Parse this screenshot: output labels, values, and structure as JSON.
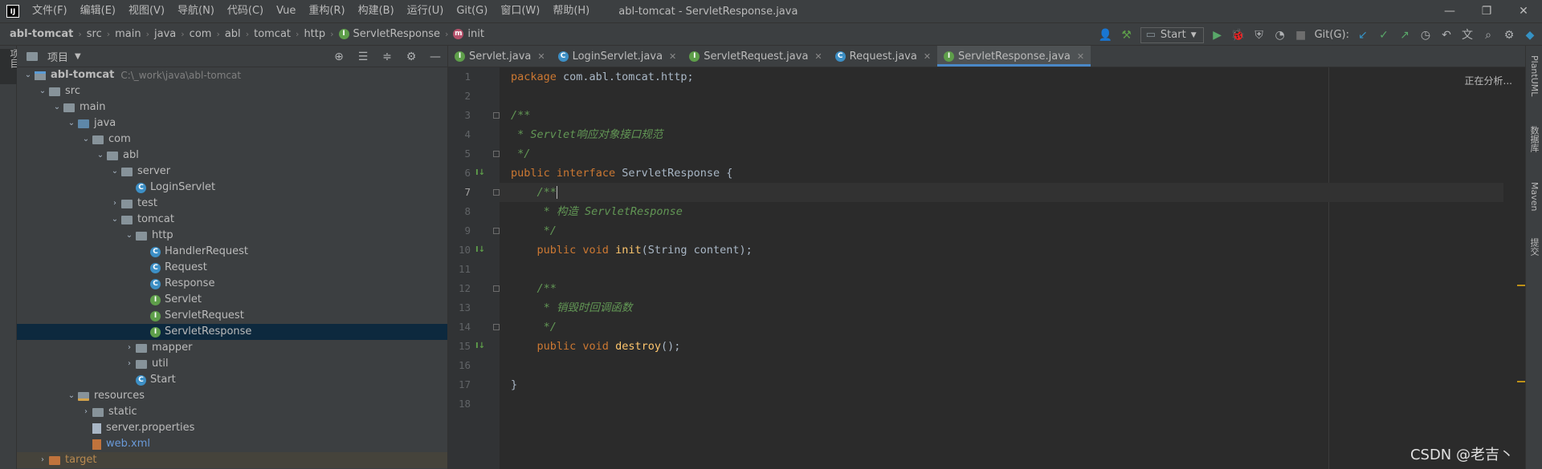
{
  "menubar": {
    "logo": "IJ",
    "items": [
      "文件(F)",
      "编辑(E)",
      "视图(V)",
      "导航(N)",
      "代码(C)",
      "Vue",
      "重构(R)",
      "构建(B)",
      "运行(U)",
      "Git(G)",
      "窗口(W)",
      "帮助(H)"
    ],
    "window_title": "abl-tomcat - ServletResponse.java"
  },
  "breadcrumb": {
    "items": [
      "abl-tomcat",
      "src",
      "main",
      "java",
      "com",
      "abl",
      "tomcat",
      "http",
      "ServletResponse",
      "init"
    ]
  },
  "toolbar": {
    "run_config": "Start",
    "git_label": "Git(G):"
  },
  "left_stripe": {
    "project_tab": "项目"
  },
  "right_stripe": {
    "tabs": [
      "PlantUML",
      "数据库",
      "Maven",
      "提交"
    ]
  },
  "project_panel": {
    "title": "项目",
    "tree": [
      {
        "label": "abl-tomcat",
        "path": "C:\\_work\\java\\abl-tomcat"
      },
      {
        "label": "src"
      },
      {
        "label": "main"
      },
      {
        "label": "java"
      },
      {
        "label": "com"
      },
      {
        "label": "abl"
      },
      {
        "label": "server"
      },
      {
        "label": "LoginServlet"
      },
      {
        "label": "test"
      },
      {
        "label": "tomcat"
      },
      {
        "label": "http"
      },
      {
        "label": "HandlerRequest"
      },
      {
        "label": "Request"
      },
      {
        "label": "Response"
      },
      {
        "label": "Servlet"
      },
      {
        "label": "ServletRequest"
      },
      {
        "label": "ServletResponse"
      },
      {
        "label": "mapper"
      },
      {
        "label": "util"
      },
      {
        "label": "Start"
      },
      {
        "label": "resources"
      },
      {
        "label": "static"
      },
      {
        "label": "server.properties"
      },
      {
        "label": "web.xml"
      },
      {
        "label": "target"
      }
    ]
  },
  "editor": {
    "tabs": [
      {
        "label": "Servlet.java"
      },
      {
        "label": "LoginServlet.java"
      },
      {
        "label": "ServletRequest.java"
      },
      {
        "label": "Request.java"
      },
      {
        "label": "ServletResponse.java"
      }
    ],
    "status": "正在分析...",
    "line_numbers": [
      "1",
      "2",
      "3",
      "4",
      "5",
      "6",
      "7",
      "8",
      "9",
      "10",
      "11",
      "12",
      "13",
      "14",
      "15",
      "16",
      "17",
      "18"
    ],
    "code": {
      "l1_kw": "package",
      "l1_rest": " com.abl.tomcat.http;",
      "l3": "/**",
      "l4": " * Servlet响应对象接口规范",
      "l5": " */",
      "l6_kw1": "public",
      "l6_kw2": "interface",
      "l6_rest": " ServletResponse {",
      "l7": "    /**",
      "l8": "     * 构造 ServletResponse",
      "l9": "     */",
      "l10_kw1": "    public",
      "l10_kw2": "void",
      "l10_fn": "init",
      "l10_rest": "(String content);",
      "l12": "    /**",
      "l13": "     * 销毁时回调函数",
      "l14": "     */",
      "l15_kw1": "    public",
      "l15_kw2": "void",
      "l15_fn": "destroy",
      "l15_rest": "();",
      "l17": "}"
    }
  },
  "watermark": "CSDN @老吉丶"
}
